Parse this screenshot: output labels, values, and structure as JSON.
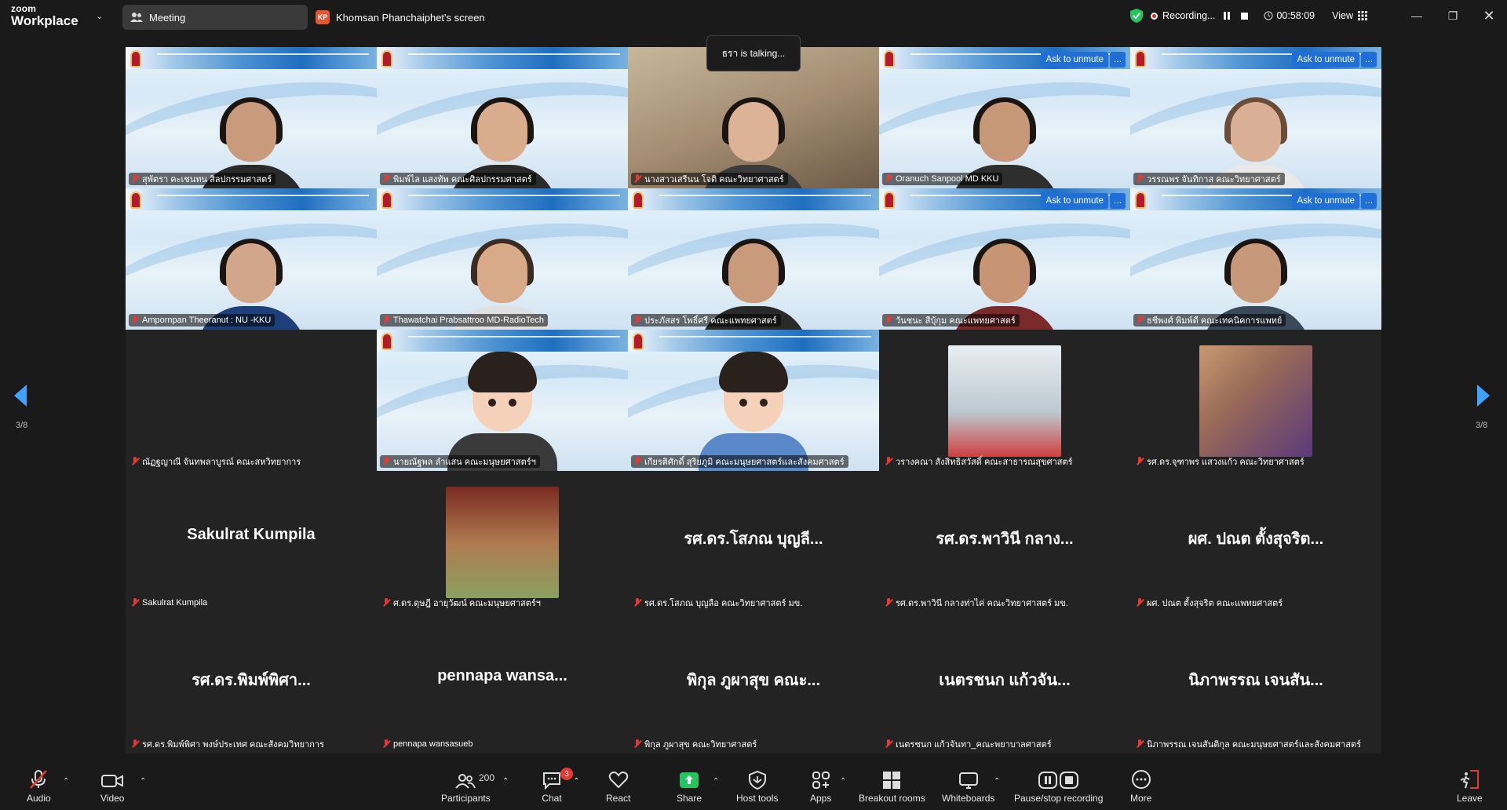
{
  "app": {
    "brand_top": "zoom",
    "brand_bottom": "Workplace"
  },
  "tabs": {
    "meeting": "Meeting",
    "share_initials": "KP",
    "share": "Khomsan Phanchaiphet's screen"
  },
  "status": {
    "recording": "Recording...",
    "timer": "00:58:09",
    "view": "View"
  },
  "talking": "ธรา is talking...",
  "ask_unmute": "Ask to unmute",
  "page": {
    "left": "3/8",
    "right": "3/8"
  },
  "tiles": [
    {
      "name": "สุพัตรา คะเชนทน สิลปกรรมศาสตร์"
    },
    {
      "name": "พิมพ์ไล แสงทัพ คณะศิลปกรรมศาสตร์"
    },
    {
      "name": "นางสาวเสรีนน โจติ คณะวิทยาศาสตร์"
    },
    {
      "name": "Oranuch Sanpool MD KKU"
    },
    {
      "name": "วรรณพร จันทิกาส คณะวิทยาศาสตร์"
    },
    {
      "name": "Ampornpan Theeranut : NU -KKU"
    },
    {
      "name": "Thawatchai Prabsattroo MD-RadioTech"
    },
    {
      "name": "ประภัสสร โพธิ์ศรี คณะแพทยศาสตร์"
    },
    {
      "name": "วันชนะ สีบุ้กุม คณะแพทยศาสตร์"
    },
    {
      "name": "ธชีพงศ์ พิมพ์ดี คณะเทคนิคการแพทย์"
    },
    {
      "name": "ณัฏฐญาณี จันทพลาบูรณ์ คณะสหวิทยาการ"
    },
    {
      "name": "นายณัฐพล ลำแสน คณะมนุษยศาสตร์ฯ"
    },
    {
      "name": "เกียรติศักดิ์ สุริยภูมิ คณะมนุษยศาสตร์และสังคมศาสตร์"
    },
    {
      "name": "วรางคณา สังสิทธิสวัสดิ์ คณะสาธารณสุขศาสตร์"
    },
    {
      "name": "รศ.ดร.จุฑาพร แสวงแก้ว คณะวิทยาศาสตร์"
    },
    {
      "big": "Sakulrat Kumpila",
      "name": "Sakulrat Kumpila"
    },
    {
      "name": "ศ.ดร.ดุษฎี อายุวัฒน์ คณะมนุษยศาสตร์ฯ"
    },
    {
      "big": "รศ.ดร.โสภณ บุญลี...",
      "name": "รศ.ดร.โสภณ บุญลือ คณะวิทยาศาสตร์ มข."
    },
    {
      "big": "รศ.ดร.พาวินี กลาง...",
      "name": "รศ.ดร.พาวินี กลางท่าไค่ คณะวิทยาศาสตร์ มข."
    },
    {
      "big": "ผศ. ปณต ตั้งสุจริต...",
      "name": "ผศ. ปณต ตั้งสุจริต คณะแพทยศาสตร์"
    },
    {
      "big": "รศ.ดร.พิมพ์พิศา...",
      "name": "รศ.ดร.พิมพ์พิศา พงษ์ประเทศ คณะสังคมวิทยาการ"
    },
    {
      "big": "pennapa  wansa...",
      "name": "pennapa  wansasueb"
    },
    {
      "big": "พิกุล ภูผาสุข คณะ...",
      "name": "พิกุล ภูผาสุข คณะวิทยาศาสตร์"
    },
    {
      "big": "เนตรชนก แก้วจัน...",
      "name": "เนตรชนก แก้วจันทา_คณะพยาบาลศาสตร์"
    },
    {
      "big": "นิภาพรรณ เจนสัน...",
      "name": "นิภาพรรณ เจนสันติกุล คณะมนุษยศาสตร์และสังคมศาสตร์"
    }
  ],
  "toolbar": {
    "audio": "Audio",
    "video": "Video",
    "participants": "Participants",
    "participants_count": "200",
    "chat": "Chat",
    "chat_badge": "3",
    "react": "React",
    "share": "Share",
    "host_tools": "Host tools",
    "apps": "Apps",
    "breakout": "Breakout rooms",
    "whiteboards": "Whiteboards",
    "recording": "Pause/stop recording",
    "more": "More",
    "leave": "Leave"
  },
  "colors": {
    "accent_blue": "#1f6fd6",
    "share_green": "#22c55e",
    "leave_red": "#e53935",
    "rec_red": "#e02828"
  }
}
